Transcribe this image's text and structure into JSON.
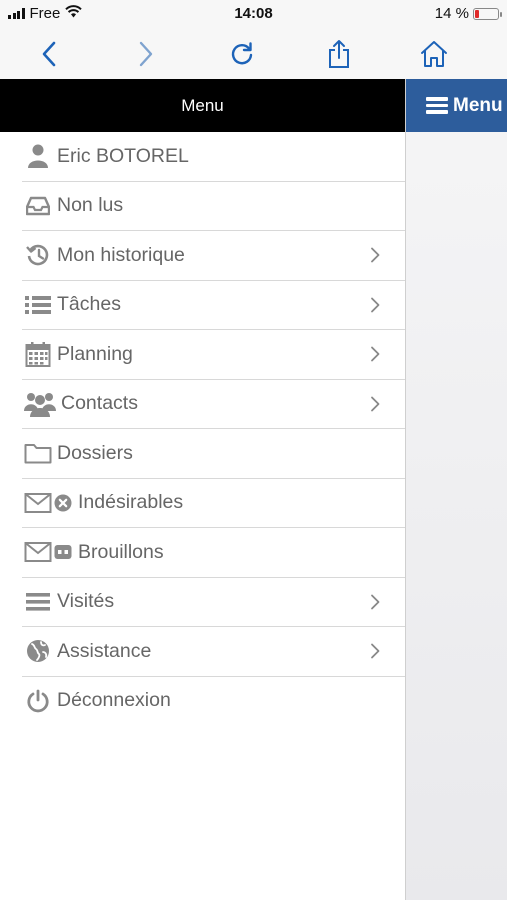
{
  "status_bar": {
    "carrier": "Free",
    "time": "14:08",
    "battery": "14 %"
  },
  "header": {
    "title": "Menu"
  },
  "right_panel": {
    "menu_button_label": "Menu"
  },
  "menu": {
    "items": [
      {
        "label": "Eric BOTOREL",
        "icon": "user-icon",
        "chevron": false
      },
      {
        "label": "Non lus",
        "icon": "inbox-icon",
        "chevron": false
      },
      {
        "label": "Mon historique",
        "icon": "history-icon",
        "chevron": true
      },
      {
        "label": "Tâches",
        "icon": "task-list-icon",
        "chevron": true
      },
      {
        "label": "Planning",
        "icon": "calendar-icon",
        "chevron": true
      },
      {
        "label": "Contacts",
        "icon": "users-icon",
        "chevron": true
      },
      {
        "label": "Dossiers",
        "icon": "folder-icon",
        "chevron": false
      },
      {
        "label": "Indésirables",
        "icon": "envelope-icon",
        "chevron": false
      },
      {
        "label": "Brouillons",
        "icon": "envelope-icon",
        "chevron": false
      },
      {
        "label": "Visités",
        "icon": "bars-icon",
        "chevron": true
      },
      {
        "label": "Assistance",
        "icon": "globe-icon",
        "chevron": true
      },
      {
        "label": "Déconnexion",
        "icon": "power-icon",
        "chevron": false
      }
    ]
  },
  "colors": {
    "accent": "#2d5d9c",
    "header_bg": "#000000",
    "battery_low": "#e02a2a",
    "text": "#666666"
  }
}
